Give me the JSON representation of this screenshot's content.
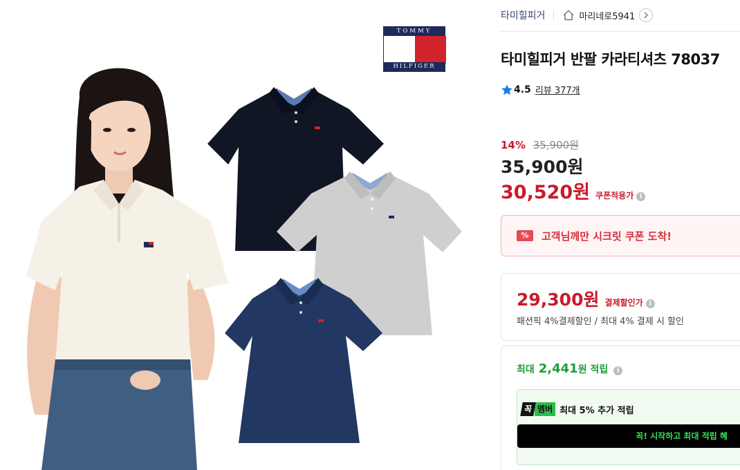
{
  "colors": {
    "brand_navy": "#1d2a5a",
    "brand_red": "#d1232c",
    "sale_red": "#c81b2c",
    "point_green": "#1f9b3a",
    "coupon_bg": "#fff5f5"
  },
  "hero": {
    "logo": {
      "top_text": "TOMMY",
      "bottom_text": "HILFIGER"
    },
    "shirt_colors": [
      "#101624",
      "#cfcfcf",
      "#223761",
      "#f6f1e7"
    ]
  },
  "header": {
    "brand": "타미힐피거",
    "home_icon": "home-icon",
    "store": "마리네로5941",
    "store_chevron_icon": "chevron-right-icon"
  },
  "product": {
    "title": "타미힐피거 반팔 카라티셔츠 78037",
    "rating": {
      "icon": "star-icon",
      "score": "4.5",
      "reviews_label": "리뷰 377개"
    },
    "discount_rate": "14%",
    "original_price": "35,900원",
    "price": "35,900원",
    "coupon_price": "30,520원",
    "coupon_price_label": "쿠폰적용가",
    "info_icon": "info-icon"
  },
  "coupon_banner": {
    "icon": "coupon-icon",
    "icon_text": "%",
    "text": "고객님께만 시크릿 쿠폰 도착!"
  },
  "payment": {
    "price": "29,300원",
    "label": "결제할인가",
    "desc": "패션픽 4%결제할인 / 최대 4% 결제 시 할인"
  },
  "earn": {
    "prefix": "최대",
    "amount": "2,441",
    "suffix": "원 적립",
    "member": {
      "badge_1": "꼭",
      "badge_2": "멤버",
      "text": "최대 5% 추가 적립",
      "cta": "꼭! 시작하고 최대 적립 혜"
    }
  }
}
